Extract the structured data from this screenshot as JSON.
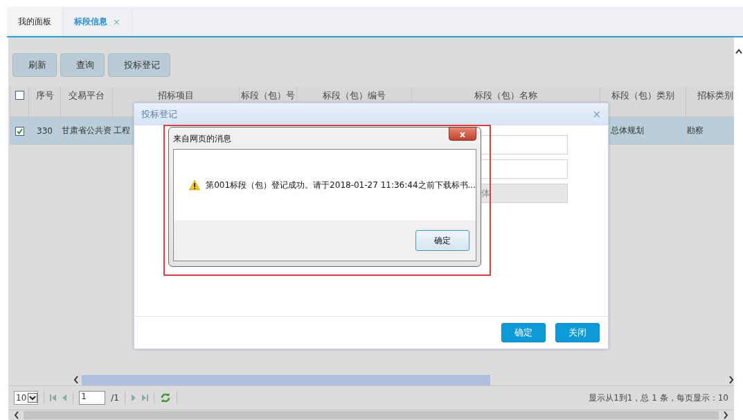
{
  "tabs": [
    {
      "label": "我的面板",
      "selected": false,
      "closable": false
    },
    {
      "label": "标段信息",
      "selected": true,
      "closable": true,
      "close": "×"
    }
  ],
  "toolbar": {
    "buttons": [
      "刷新",
      "查询",
      "投标登记"
    ]
  },
  "table": {
    "select_all": {
      "checked": false
    },
    "columns": [
      "序号",
      "交易平台",
      "招标项目",
      "标段（包）号",
      "标段（包）编号",
      "标段（包）名称",
      "标段（包）类别",
      "招标类别"
    ],
    "rows": [
      {
        "selected": true,
        "checked": true,
        "cells": [
          "330",
          "甘肃省公共资",
          "工程",
          "",
          "",
          "",
          "总体规划",
          "勘察"
        ]
      }
    ]
  },
  "pager": {
    "page_size": "10",
    "page": "1",
    "total_pages": "/1",
    "summary": "显示从1到1，总 1 条，每页显示：10"
  },
  "dialog": {
    "title": "投标登记",
    "close": "×",
    "fields": [
      {
        "kind": "input"
      },
      {
        "kind": "input"
      },
      {
        "kind": "readonly",
        "value": "体"
      }
    ],
    "buttons": [
      "确定",
      "关闭"
    ]
  },
  "message_box": {
    "title": "来自网页的消息",
    "close": "x",
    "message": "第001标段（包）登记成功。请于2018-01-27 11:36:44之前下载标书...",
    "button": "确定",
    "highlighted": true
  }
}
